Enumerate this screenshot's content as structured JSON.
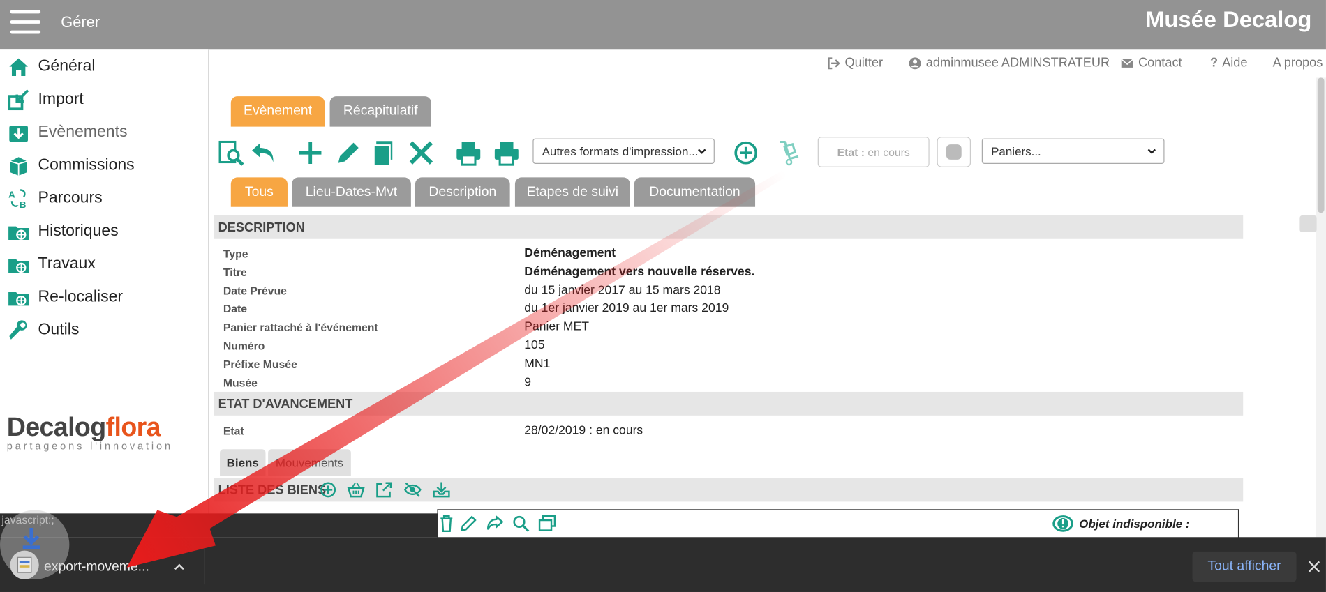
{
  "header": {
    "menu_label": "Gérer",
    "app_title": "Musée Decalog"
  },
  "sidebar": {
    "items": [
      {
        "label": "Général",
        "icon": "home-icon"
      },
      {
        "label": "Import",
        "icon": "import-icon"
      },
      {
        "label": "Evènements",
        "icon": "events-icon"
      },
      {
        "label": "Commissions",
        "icon": "commissions-icon"
      },
      {
        "label": "Parcours",
        "icon": "parcours-icon"
      },
      {
        "label": "Historiques",
        "icon": "historiques-icon"
      },
      {
        "label": "Travaux",
        "icon": "travaux-icon"
      },
      {
        "label": "Re-localiser",
        "icon": "relocate-icon"
      },
      {
        "label": "Outils",
        "icon": "wrench-icon"
      }
    ],
    "logo": {
      "brand_a": "Decalog",
      "brand_b": "flora",
      "tagline": "partageons l'innovation"
    }
  },
  "toplinks": {
    "quit": "Quitter",
    "user": "adminmusee ADMINSTRATEUR",
    "contact": "Contact",
    "help": "Aide",
    "about": "A propos"
  },
  "main_tabs": [
    "Evènement",
    "Récapitulatif"
  ],
  "toolbar": {
    "print_formats": "Autres formats d'impression...",
    "etat_label": "Etat :",
    "etat_value": "en cours",
    "paniers": "Paniers..."
  },
  "sub_tabs": [
    "Tous",
    "Lieu-Dates-Mvt",
    "Description",
    "Etapes de suivi",
    "Documentation"
  ],
  "description": {
    "title": "DESCRIPTION",
    "fields": [
      {
        "label": "Type",
        "value": "Déménagement"
      },
      {
        "label": "Titre",
        "value": "Déménagement vers nouvelle réserves."
      },
      {
        "label": "Date Prévue",
        "value": "du 15 janvier 2017 au 15 mars 2018"
      },
      {
        "label": "Date",
        "value": "du 1er janvier 2019 au 1er mars 2019"
      },
      {
        "label": "Panier rattaché à l'événement",
        "value": "Panier MET"
      },
      {
        "label": "Numéro",
        "value": "105"
      },
      {
        "label": "Préfixe Musée",
        "value": "MN1"
      },
      {
        "label": "Musée",
        "value": "9"
      }
    ]
  },
  "avancement": {
    "title": "ETAT D'AVANCEMENT",
    "label": "Etat",
    "value": "28/02/2019 : en cours"
  },
  "list_tabs": [
    "Biens",
    "Mouvements"
  ],
  "list": {
    "title": "LISTE DES BIENS",
    "unavailable": "Objet indisponible :"
  },
  "status_text": "javascript:;",
  "download": {
    "filename": "export-moveme...",
    "show_all": "Tout afficher"
  },
  "colors": {
    "teal": "#1a9e88",
    "orange_tab": "#f7a643",
    "gray_tab": "#9b9b9b",
    "header": "#939393",
    "arrow": "#e81c1c"
  }
}
